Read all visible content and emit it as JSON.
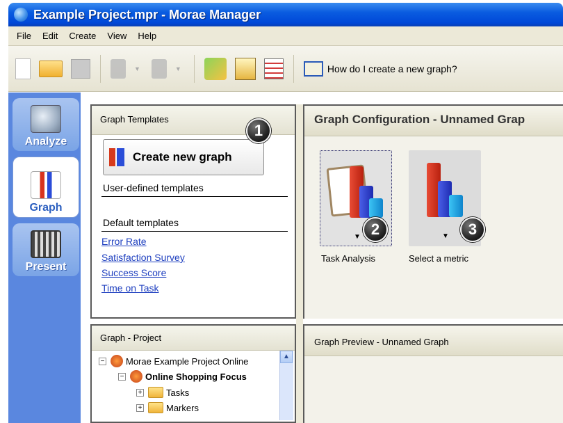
{
  "window": {
    "title": "Example Project.mpr - Morae Manager"
  },
  "menu": [
    "File",
    "Edit",
    "Create",
    "View",
    "Help"
  ],
  "toolbar": {
    "help_question": "How do I create a new graph?"
  },
  "left_tabs": [
    {
      "label": "Analyze",
      "icon": "magnifier-icon",
      "active": false
    },
    {
      "label": "Graph",
      "icon": "graph-icon",
      "active": true
    },
    {
      "label": "Present",
      "icon": "film-icon",
      "active": false
    }
  ],
  "templates_panel": {
    "title": "Graph Templates",
    "create_button": "Create new graph",
    "user_defined_heading": "User-defined templates",
    "default_heading": "Default templates",
    "default_templates": [
      "Error Rate",
      "Satisfaction Survey",
      "Success Score",
      "Time on Task"
    ]
  },
  "project_panel": {
    "title": "Graph - Project",
    "tree": [
      {
        "label": "Morae Example Project Online",
        "expander": "−",
        "bold": false
      },
      {
        "label": "Online Shopping Focus",
        "expander": "−",
        "bold": true
      },
      {
        "label": "Tasks",
        "expander": "+",
        "bold": false
      },
      {
        "label": "Markers",
        "expander": "+",
        "bold": false
      }
    ]
  },
  "config_panel": {
    "title": "Graph Configuration - Unnamed Grap",
    "options": [
      {
        "label": "Task Analysis",
        "selected": true
      },
      {
        "label": "Select a metric",
        "selected": false
      }
    ]
  },
  "preview_panel": {
    "title": "Graph Preview - Unnamed Graph"
  },
  "callouts": [
    "1",
    "2",
    "3"
  ],
  "colors": {
    "title_bar": "#0a5ce0",
    "left_tab_bg": "#5a87df",
    "link": "#1e3fbf"
  }
}
